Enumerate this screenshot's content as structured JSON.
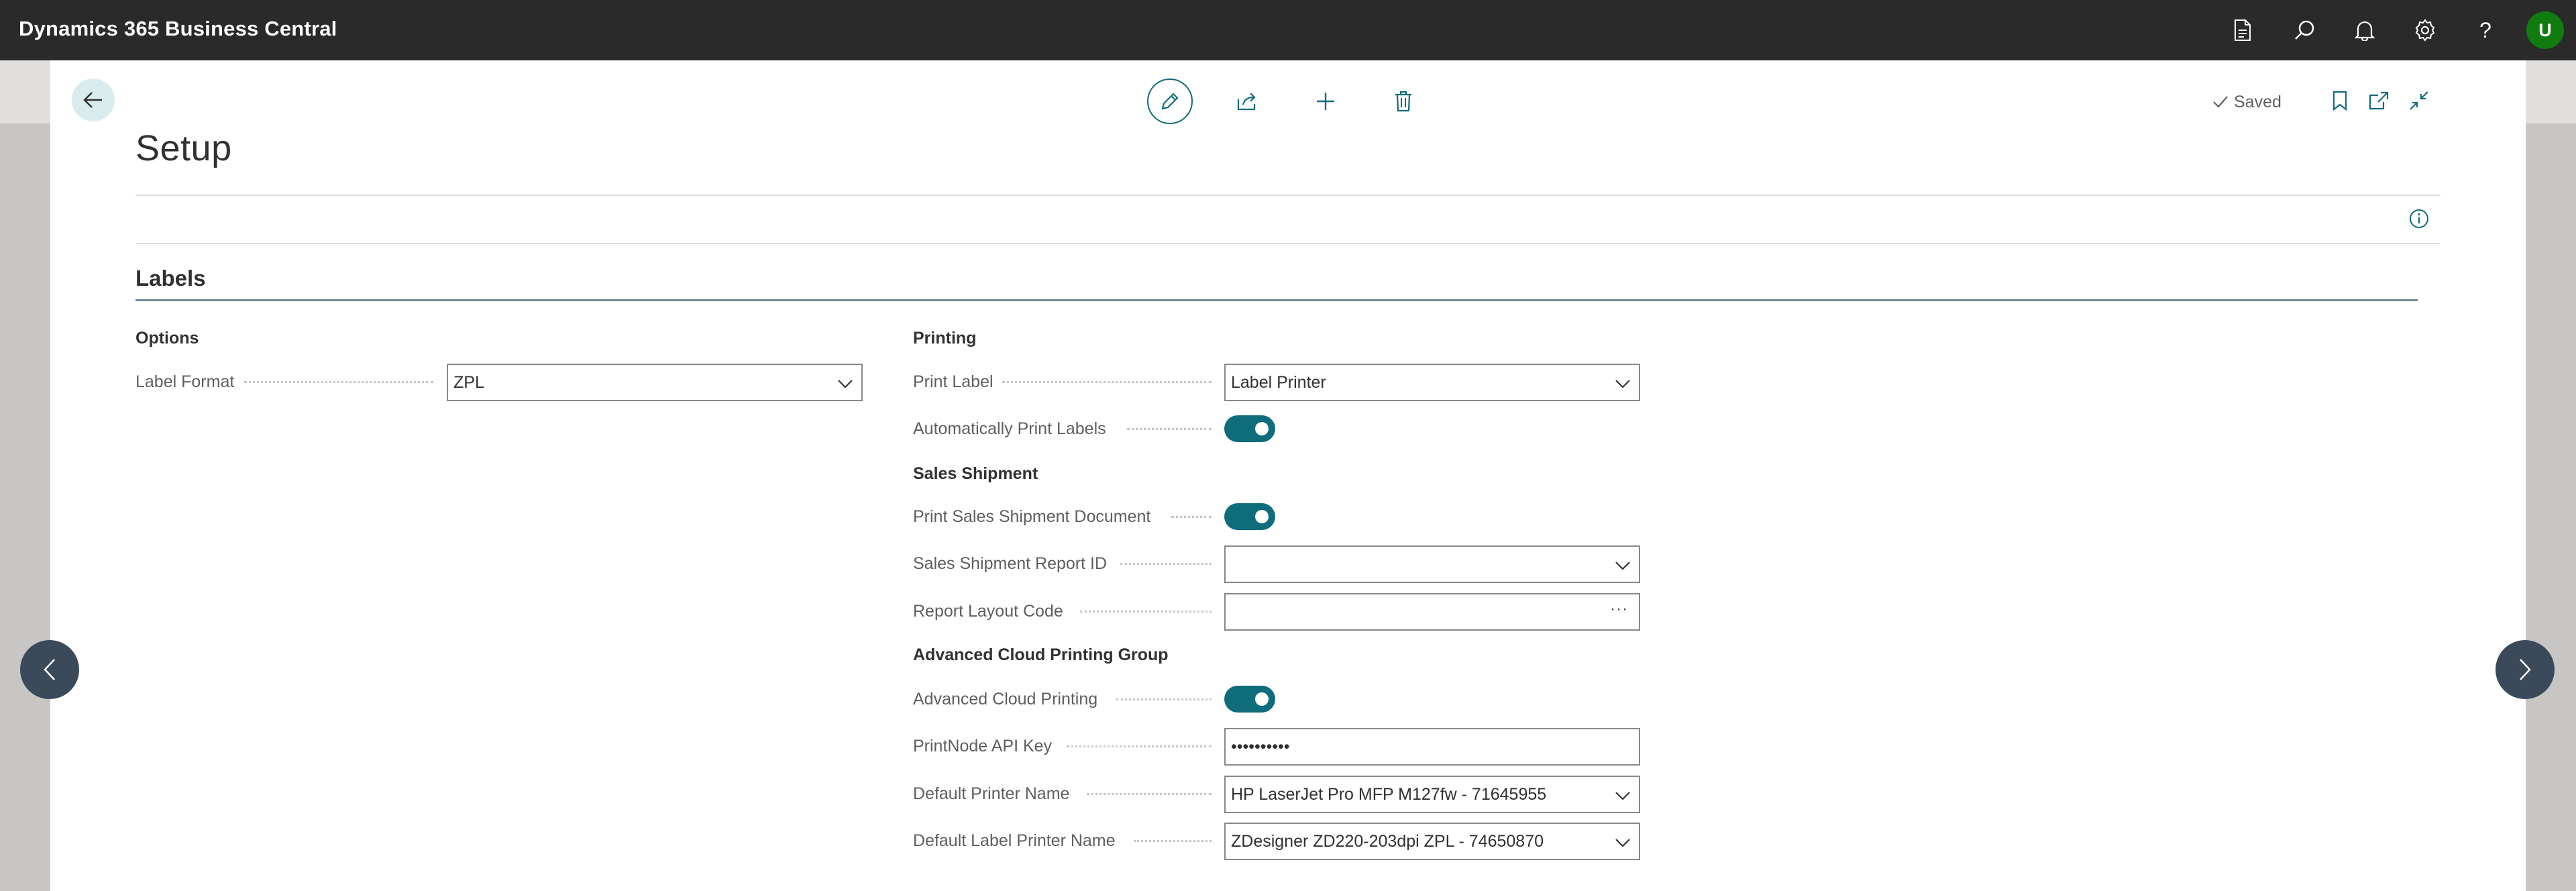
{
  "app": {
    "title": "Dynamics 365 Business Central",
    "user_initial": "U"
  },
  "header": {
    "page_title": "Setup",
    "saved_label": "Saved"
  },
  "section": {
    "title": "Labels"
  },
  "options": {
    "title": "Options",
    "label_format": {
      "label": "Label Format",
      "value": "ZPL"
    }
  },
  "printing": {
    "title": "Printing",
    "print_label": {
      "label": "Print Label",
      "value": "Label Printer"
    },
    "auto_print": {
      "label": "Automatically Print Labels",
      "on": true
    }
  },
  "sales_shipment": {
    "title": "Sales Shipment",
    "print_doc": {
      "label": "Print Sales Shipment Document",
      "on": true
    },
    "report_id": {
      "label": "Sales Shipment Report ID",
      "value": ""
    },
    "layout_code": {
      "label": "Report Layout Code",
      "value": ""
    }
  },
  "cloud": {
    "title": "Advanced Cloud Printing Group",
    "enabled": {
      "label": "Advanced Cloud Printing",
      "on": true
    },
    "api_key": {
      "label": "PrintNode API Key",
      "value": "••••••••••"
    },
    "default_printer": {
      "label": "Default Printer Name",
      "value": "HP LaserJet Pro MFP M127fw - 71645955"
    },
    "default_label_printer": {
      "label": "Default Label Printer Name",
      "value": "ZDesigner ZD220-203dpi ZPL - 74650870"
    }
  },
  "colors": {
    "accent": "#0f6c7b",
    "topbar": "#2a2a2a",
    "avatar": "#107c10"
  }
}
